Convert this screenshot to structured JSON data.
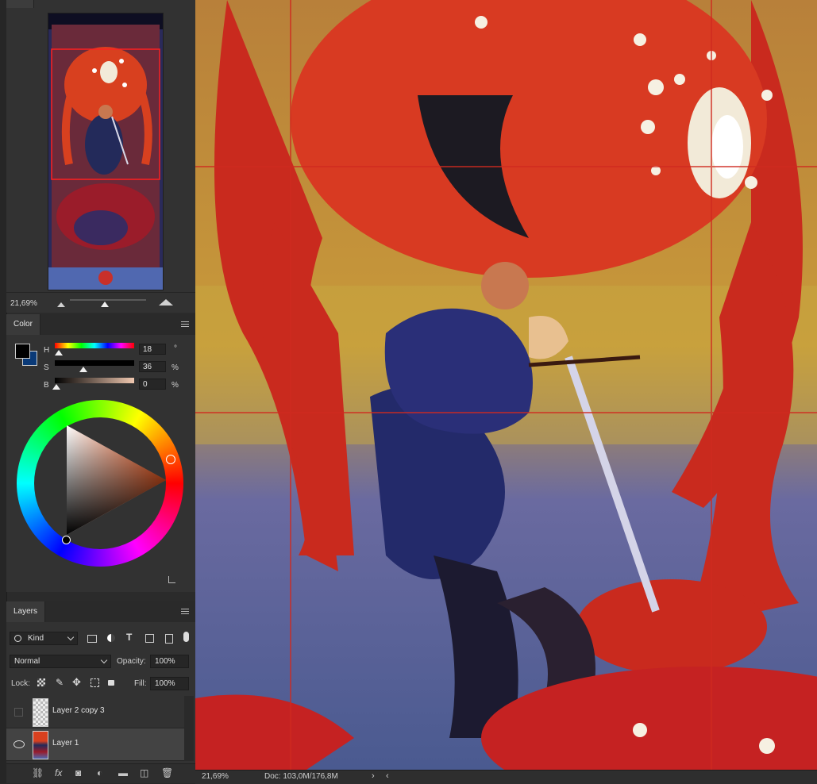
{
  "navigator": {
    "zoom": "21,69%"
  },
  "color": {
    "tab_label": "Color",
    "h_label": "H",
    "s_label": "S",
    "b_label": "B",
    "h_value": "18",
    "s_value": "36",
    "b_value": "0",
    "h_unit": "°",
    "s_unit": "%",
    "b_unit": "%",
    "foreground": "#000000",
    "background": "#0a3a78"
  },
  "layers": {
    "tab_label": "Layers",
    "filter_kind": "Kind",
    "blend_mode": "Normal",
    "opacity_label": "Opacity:",
    "opacity_value": "100%",
    "lock_label": "Lock:",
    "fill_label": "Fill:",
    "fill_value": "100%",
    "items": [
      {
        "name": "Layer 2 copy 3",
        "visible": false,
        "selected": false
      },
      {
        "name": "Layer 1",
        "visible": true,
        "selected": true
      }
    ]
  },
  "status": {
    "zoom": "21,69%",
    "doc": "Doc: 103,0M/176,8M"
  }
}
